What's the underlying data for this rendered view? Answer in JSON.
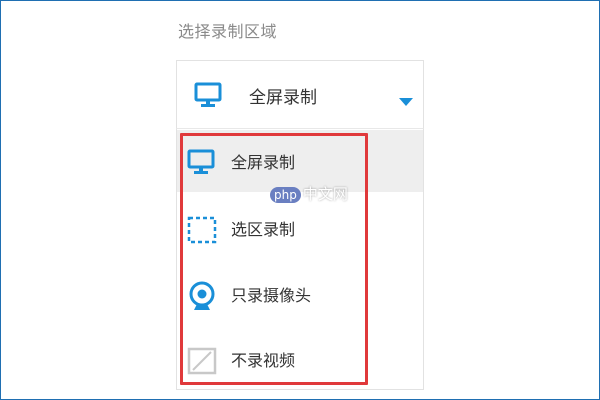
{
  "section_label": "选择录制区域",
  "select": {
    "selected_label": "全屏录制",
    "selected_icon": "monitor-icon",
    "caret_icon": "caret-down-icon"
  },
  "options": [
    {
      "label": "全屏录制",
      "icon": "monitor-icon",
      "highlighted": true
    },
    {
      "label": "选区录制",
      "icon": "dashed-selection-icon",
      "highlighted": false
    },
    {
      "label": "只录摄像头",
      "icon": "webcam-icon",
      "highlighted": false
    },
    {
      "label": "不录视频",
      "icon": "no-video-icon",
      "highlighted": false
    }
  ],
  "watermark": {
    "brand": "php",
    "suffix": "中文网"
  },
  "colors": {
    "accent": "#1a8fd8",
    "highlight_bg": "#eeeeee",
    "annotation_red": "#e0393b",
    "border": "#e2e2e2",
    "label_gray": "#8a8a8a",
    "text": "#333333",
    "disabled_icon": "#c8c8c8"
  }
}
